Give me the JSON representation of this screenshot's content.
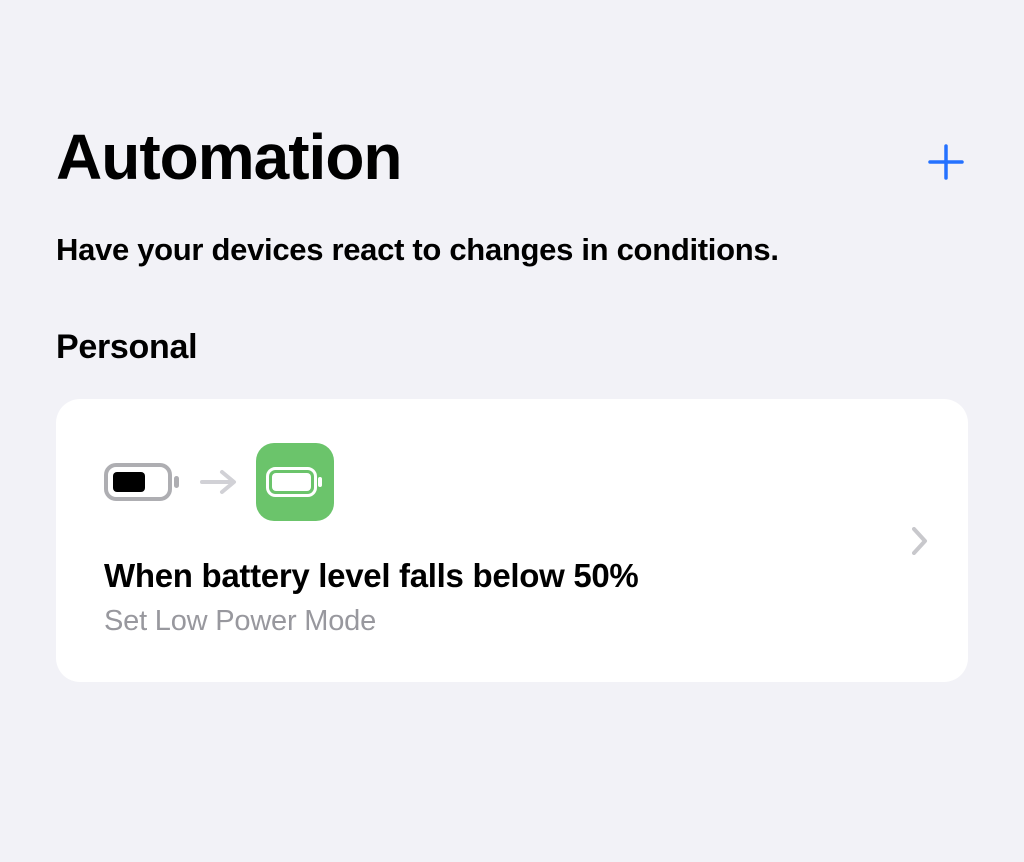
{
  "header": {
    "title": "Automation",
    "subtitle": "Have your devices react to changes in conditions."
  },
  "sections": [
    {
      "header": "Personal",
      "items": [
        {
          "title": "When battery level falls below 50%",
          "subtitle": "Set Low Power Mode",
          "trigger_icon": "battery-outline-icon",
          "action_icon": "battery-full-green-icon"
        }
      ]
    }
  ],
  "colors": {
    "background": "#f2f2f7",
    "card": "#ffffff",
    "accent": "#2471ff",
    "green": "#6bc46b",
    "secondary_text": "#98989e",
    "light_gray": "#c8c8cc"
  }
}
